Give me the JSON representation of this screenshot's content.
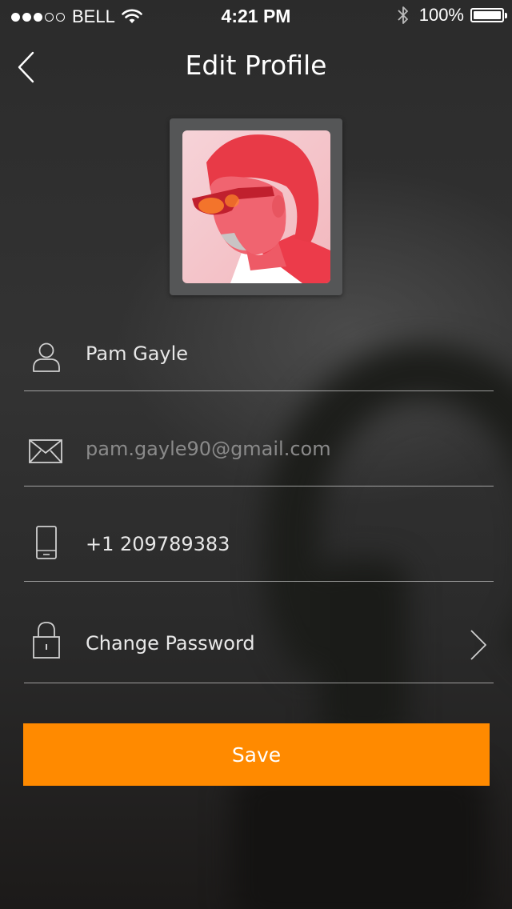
{
  "status_bar": {
    "signal_dots_full": 3,
    "signal_dots_empty": 2,
    "carrier": "BELL",
    "time": "4:21 PM",
    "battery": "100%",
    "icons": [
      "wifi-icon",
      "bluetooth-icon",
      "battery-icon"
    ]
  },
  "header": {
    "title": "Edit Profile",
    "back_icon": "back-chevron-icon"
  },
  "profile": {
    "avatar": "profile-photo"
  },
  "form": {
    "name": {
      "value": "Pam Gayle",
      "icon": "user-icon"
    },
    "email": {
      "placeholder": "pam.gayle90@gmail.com",
      "icon": "mail-icon"
    },
    "phone": {
      "value": "+1 209789383",
      "icon": "phone-icon"
    },
    "password": {
      "label": "Change Password",
      "icon": "lock-icon",
      "chevron": "chevron-right-icon"
    }
  },
  "actions": {
    "save_label": "Save"
  },
  "colors": {
    "accent": "#ff8a00",
    "background": "#2e2e2e",
    "divider": "#bfbfbf"
  }
}
